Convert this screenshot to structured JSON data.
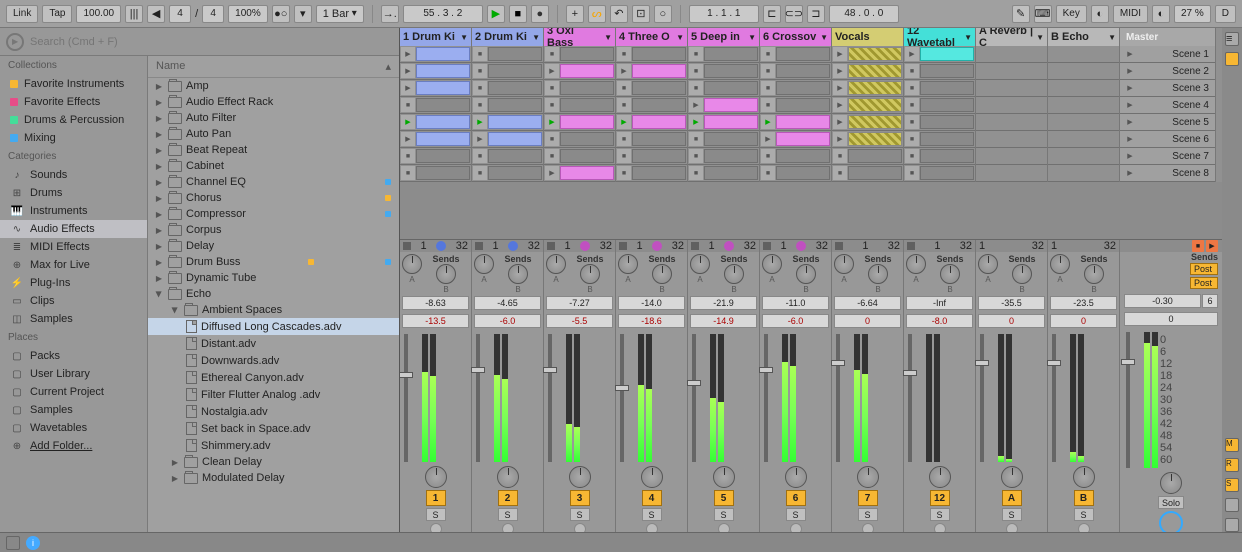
{
  "toolbar": {
    "link": "Link",
    "tap": "Tap",
    "tempo": "100.00",
    "sig_num": "4",
    "sig_den": "4",
    "zoom": "100%",
    "quantize": "1 Bar",
    "position": "55 .  3 .  2",
    "loop_pos": "1 .  1 .  1",
    "loop_len": "48 .  0 .  0",
    "key": "Key",
    "midi": "MIDI",
    "cpu": "27 %",
    "disk": "D"
  },
  "search": {
    "placeholder": "Search (Cmd + F)"
  },
  "browser": {
    "collections_hdr": "Collections",
    "collections": [
      {
        "label": "Favorite Instruments",
        "color": "#f7b733"
      },
      {
        "label": "Favorite Effects",
        "color": "#e74c88"
      },
      {
        "label": "Drums & Percussion",
        "color": "#44dd99"
      },
      {
        "label": "Mixing",
        "color": "#44aaf0"
      }
    ],
    "categories_hdr": "Categories",
    "categories": [
      "Sounds",
      "Drums",
      "Instruments",
      "Audio Effects",
      "MIDI Effects",
      "Max for Live",
      "Plug-Ins",
      "Clips",
      "Samples"
    ],
    "cat_selected": "Audio Effects",
    "places_hdr": "Places",
    "places": [
      "Packs",
      "User Library",
      "Current Project",
      "Samples",
      "Wavetables",
      "Add Folder..."
    ],
    "name_hdr": "Name",
    "devices": [
      {
        "label": "Amp",
        "dot": ""
      },
      {
        "label": "Audio Effect Rack",
        "dot": ""
      },
      {
        "label": "Auto Filter",
        "dot": ""
      },
      {
        "label": "Auto Pan",
        "dot": ""
      },
      {
        "label": "Beat Repeat",
        "dot": ""
      },
      {
        "label": "Cabinet",
        "dot": ""
      },
      {
        "label": "Channel EQ",
        "dot": "#44aaf0"
      },
      {
        "label": "Chorus",
        "dot": "#f7b733"
      },
      {
        "label": "Compressor",
        "dot": "#44aaf0"
      },
      {
        "label": "Corpus",
        "dot": ""
      },
      {
        "label": "Delay",
        "dot": ""
      },
      {
        "label": "Drum Buss",
        "dot": "#f7b733"
      },
      {
        "label": "Dynamic Tube",
        "dot": ""
      },
      {
        "label": "Echo",
        "dot": "",
        "open": true
      }
    ],
    "echo_folder": "Ambient Spaces",
    "presets": [
      "Diffused Long Cascades.adv",
      "Distant.adv",
      "Downwards.adv",
      "Ethereal Canyon.adv",
      "Filter Flutter Analog .adv",
      "Nostalgia.adv",
      "Set back in Space.adv",
      "Shimmery.adv"
    ],
    "preset_selected": "Diffused Long Cascades.adv",
    "after": [
      "Clean Delay",
      "Modulated Delay"
    ]
  },
  "tracks": [
    {
      "name": "1 Drum Ki",
      "cls": "th-blue"
    },
    {
      "name": "2 Drum Ki",
      "cls": "th-blue"
    },
    {
      "name": "3 Oxi Bass",
      "cls": "th-pink"
    },
    {
      "name": "4 Three O",
      "cls": "th-pink"
    },
    {
      "name": "5 Deep in",
      "cls": "th-pink"
    },
    {
      "name": "6 Crossov",
      "cls": "th-pink"
    },
    {
      "name": "Vocals",
      "cls": "th-tan",
      "nodrop": true
    },
    {
      "name": "12 Wavetabl",
      "cls": "th-cyan"
    },
    {
      "name": "A Reverb | C",
      "cls": "th-grey",
      "ret": true
    },
    {
      "name": "B Echo",
      "cls": "th-grey",
      "ret": true
    }
  ],
  "master": "Master",
  "scenes": [
    "Scene 1",
    "Scene 2",
    "Scene 3",
    "Scene 4",
    "Scene 5",
    "Scene 6",
    "Scene 7",
    "Scene 8"
  ],
  "clips": [
    [
      "blue",
      "",
      "",
      "",
      "",
      "",
      "hatch",
      "cyan",
      "",
      ""
    ],
    [
      "blue",
      "",
      "pink",
      "pink",
      "",
      "",
      "hatch",
      "",
      "",
      ""
    ],
    [
      "blue",
      "",
      "",
      "",
      "",
      "",
      "hatch",
      "",
      "",
      ""
    ],
    [
      "",
      "",
      "",
      "",
      "pink",
      "",
      "hatch",
      "",
      "",
      ""
    ],
    [
      "blue",
      "blue",
      "pink",
      "pink",
      "pink",
      "pink",
      "hatch",
      "",
      "",
      ""
    ],
    [
      "blue",
      "blue",
      "",
      "",
      "",
      "pink",
      "hatch",
      "",
      "",
      ""
    ],
    [
      "",
      "",
      "",
      "",
      "",
      "",
      "",
      "",
      "",
      ""
    ],
    [
      "",
      "",
      "pink",
      "",
      "",
      "",
      "",
      "",
      "",
      ""
    ]
  ],
  "status_num": "32",
  "midi_dots": [
    "md-blue",
    "md-blue",
    "md-pink",
    "md-pink",
    "md-pink",
    "md-pink",
    "",
    "",
    ""
  ],
  "mixer": [
    {
      "db": "-8.63",
      "gain": "-13.5",
      "num": "1",
      "meter": 70,
      "fader": 30
    },
    {
      "db": "-4.65",
      "gain": "-6.0",
      "num": "2",
      "meter": 68,
      "fader": 26
    },
    {
      "db": "-7.27",
      "gain": "-5.5",
      "num": "3",
      "meter": 30,
      "fader": 26
    },
    {
      "db": "-14.0",
      "gain": "-18.6",
      "num": "4",
      "meter": 60,
      "fader": 40
    },
    {
      "db": "-21.9",
      "gain": "-14.9",
      "num": "5",
      "meter": 50,
      "fader": 36
    },
    {
      "db": "-11.0",
      "gain": "-6.0",
      "num": "6",
      "meter": 78,
      "fader": 26
    },
    {
      "db": "-6.64",
      "gain": "0",
      "num": "7",
      "meter": 72,
      "fader": 20
    },
    {
      "db": "-Inf",
      "gain": "-8.0",
      "num": "12",
      "meter": 0,
      "fader": 28
    },
    {
      "db": "-35.5",
      "gain": "0",
      "num": "A",
      "meter": 5,
      "fader": 20
    },
    {
      "db": "-23.5",
      "gain": "0",
      "num": "B",
      "meter": 8,
      "fader": 20
    }
  ],
  "master_mix": {
    "db": "-0.30",
    "gain": "0",
    "meter": 92,
    "fader": 20
  },
  "sends_label": "Sends",
  "send_a": "A",
  "send_b": "B",
  "s": "S",
  "post": "Post",
  "solo": "Solo",
  "scale": [
    "0",
    "6",
    "12",
    "18",
    "24",
    "30",
    "36",
    "42",
    "48",
    "54",
    "60"
  ]
}
